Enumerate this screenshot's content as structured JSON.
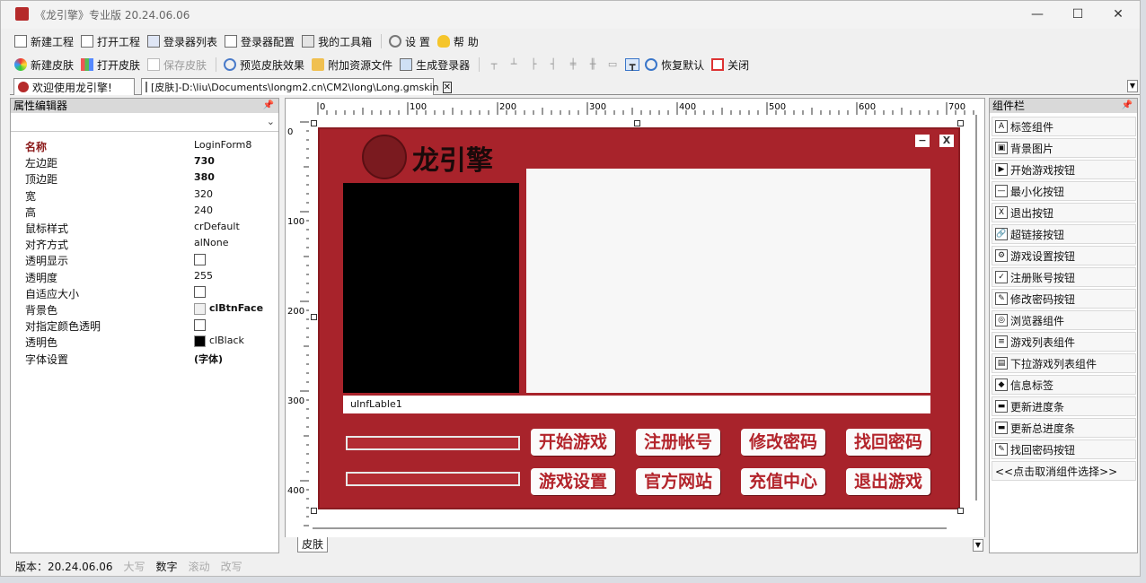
{
  "window": {
    "title": "《龙引擎》专业版 20.24.06.06"
  },
  "toolbar1": [
    "新建工程",
    "打开工程",
    "登录器列表",
    "登录器配置",
    "我的工具箱",
    "设 置",
    "帮 助"
  ],
  "toolbar2": {
    "new_skin": "新建皮肤",
    "open_skin": "打开皮肤",
    "save_skin": "保存皮肤",
    "preview": "预览皮肤效果",
    "attach": "附加资源文件",
    "generate": "生成登录器",
    "restore": "恢复默认",
    "close": "关闭"
  },
  "tabs": {
    "welcome": "欢迎使用龙引擎!",
    "skin": "[皮肤]-D:\\liu\\Documents\\longm2.cn\\CM2\\long\\Long.gmskin"
  },
  "properties": {
    "title": "属性编辑器",
    "rows": [
      {
        "name": "名称",
        "value": "LoginForm8"
      },
      {
        "name": "左边距",
        "value": "730"
      },
      {
        "name": "顶边距",
        "value": "380"
      },
      {
        "name": "宽",
        "value": "320"
      },
      {
        "name": "高",
        "value": "240"
      },
      {
        "name": "鼠标样式",
        "value": "crDefault"
      },
      {
        "name": "对齐方式",
        "value": "alNone"
      },
      {
        "name": "透明显示",
        "value": ""
      },
      {
        "name": "透明度",
        "value": "255"
      },
      {
        "name": "自适应大小",
        "value": ""
      },
      {
        "name": "背景色",
        "value": "clBtnFace"
      },
      {
        "name": "对指定颜色透明",
        "value": ""
      },
      {
        "name": "透明色",
        "value": "clBlack"
      },
      {
        "name": "字体设置",
        "value": "(字体)"
      }
    ]
  },
  "ruler": {
    "h": [
      "0",
      "100",
      "200",
      "300",
      "400",
      "500",
      "600",
      "700"
    ],
    "v": [
      "0",
      "100",
      "200",
      "300",
      "400"
    ]
  },
  "form": {
    "logo": "龙引擎",
    "min": "−",
    "close": "X",
    "info_label": "uInfLable1",
    "buttons_row1": [
      "开始游戏",
      "注册帐号",
      "修改密码",
      "找回密码"
    ],
    "buttons_row2": [
      "游戏设置",
      "官方网站",
      "充值中心",
      "退出游戏"
    ]
  },
  "design_tab": "皮肤",
  "components": {
    "title": "组件栏",
    "items": [
      "标签组件",
      "背景图片",
      "开始游戏按钮",
      "最小化按钮",
      "退出按钮",
      "超链接按钮",
      "游戏设置按钮",
      "注册账号按钮",
      "修改密码按钮",
      "浏览器组件",
      "游戏列表组件",
      "下拉游戏列表组件",
      "信息标签",
      "更新进度条",
      "更新总进度条",
      "找回密码按钮",
      "<<点击取消组件选择>>"
    ]
  },
  "status": {
    "version": "版本：20.24.06.06",
    "caps": "大写",
    "num": "数字",
    "scroll": "滚动",
    "ins": "改写"
  },
  "colors": {
    "form_bg": "#a8232b",
    "btn_text": "#b3242b"
  }
}
